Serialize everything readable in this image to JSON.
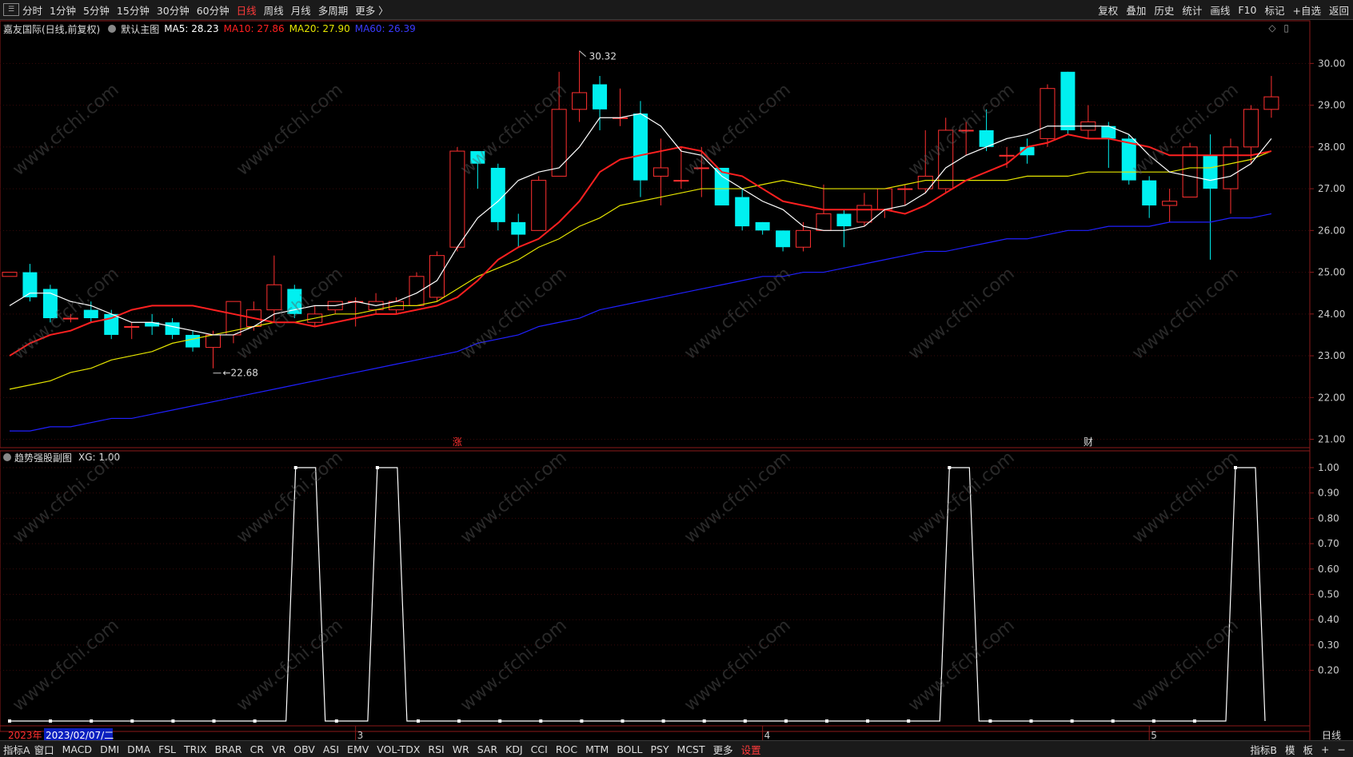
{
  "topbar": {
    "tabs": [
      "分时",
      "1分钟",
      "5分钟",
      "15分钟",
      "30分钟",
      "60分钟",
      "日线",
      "周线",
      "月线",
      "多周期",
      "更多 〉"
    ],
    "active_tab": "日线",
    "tools": [
      "复权",
      "叠加",
      "历史",
      "统计",
      "画线",
      "F10",
      "标记",
      "+自选",
      "返回"
    ]
  },
  "infobar": {
    "stock": "嘉友国际(日线,前复权)",
    "main_chart": "默认主图",
    "ma5": "MA5: 28.23",
    "ma10": "MA10: 27.86",
    "ma20": "MA20: 27.90",
    "ma60": "MA60: 26.39",
    "colors": {
      "ma5": "#ffffff",
      "ma10": "#ff2020",
      "ma20": "#e5e500",
      "ma60": "#2020ff"
    }
  },
  "main_chart": {
    "y_ticks": [
      "30.00",
      "29.00",
      "28.00",
      "27.00",
      "26.00",
      "25.00",
      "24.00",
      "23.00",
      "22.00",
      "21.00"
    ],
    "high_label": "30.32",
    "low_label": "22.68",
    "event_labels": [
      "涨",
      "财"
    ]
  },
  "sub_chart": {
    "title": "趋势强股副图",
    "value": "XG: 1.00",
    "y_ticks": [
      "1.00",
      "0.90",
      "0.80",
      "0.70",
      "0.60",
      "0.50",
      "0.40",
      "0.30",
      "0.20"
    ]
  },
  "date_axis": {
    "year": "2023年",
    "cursor_date": "2023/02/07/二",
    "month_marks": [
      "3",
      "4",
      "5"
    ],
    "period": "日线"
  },
  "chart_data": {
    "type": "candlestick",
    "candles": [
      [
        24.9,
        25.0,
        24.9,
        25.0
      ],
      [
        25.0,
        24.4,
        25.2,
        24.3
      ],
      [
        24.6,
        23.9,
        24.7,
        23.8
      ],
      [
        23.9,
        23.9,
        24.0,
        23.8
      ],
      [
        24.1,
        23.9,
        24.3,
        23.8
      ],
      [
        24.0,
        23.5,
        24.1,
        23.4
      ],
      [
        23.7,
        23.7,
        23.8,
        23.4
      ],
      [
        23.8,
        23.7,
        24.0,
        23.5
      ],
      [
        23.8,
        23.5,
        23.9,
        23.4
      ],
      [
        23.5,
        23.2,
        23.6,
        23.1
      ],
      [
        23.2,
        23.5,
        23.6,
        22.7
      ],
      [
        23.5,
        24.3,
        24.3,
        23.3
      ],
      [
        23.7,
        24.1,
        24.3,
        23.6
      ],
      [
        24.1,
        24.7,
        25.4,
        23.8
      ],
      [
        24.6,
        24.0,
        24.7,
        23.9
      ],
      [
        23.8,
        24.0,
        24.2,
        23.7
      ],
      [
        24.1,
        24.3,
        24.3,
        24.0
      ],
      [
        24.3,
        24.3,
        24.4,
        23.7
      ],
      [
        24.1,
        24.3,
        24.5,
        24.0
      ],
      [
        24.1,
        24.3,
        24.4,
        24.0
      ],
      [
        24.2,
        24.9,
        25.0,
        24.2
      ],
      [
        24.4,
        25.4,
        25.5,
        24.3
      ],
      [
        25.6,
        27.9,
        28.0,
        25.5
      ],
      [
        27.9,
        27.6,
        27.9,
        27.0
      ],
      [
        27.5,
        26.2,
        27.6,
        26.0
      ],
      [
        26.2,
        25.9,
        26.4,
        25.6
      ],
      [
        26.0,
        27.2,
        27.3,
        26.0
      ],
      [
        27.3,
        28.9,
        29.8,
        27.5
      ],
      [
        28.9,
        29.3,
        30.3,
        28.6
      ],
      [
        29.5,
        28.9,
        29.7,
        28.4
      ],
      [
        28.7,
        28.7,
        29.4,
        28.5
      ],
      [
        28.8,
        27.2,
        29.1,
        26.8
      ],
      [
        27.3,
        27.5,
        28.2,
        26.6
      ],
      [
        27.2,
        27.2,
        28.0,
        27.0
      ],
      [
        27.5,
        27.5,
        28.0,
        26.8
      ],
      [
        27.5,
        26.6,
        27.5,
        26.6
      ],
      [
        26.8,
        26.1,
        27.0,
        26.0
      ],
      [
        26.2,
        26.0,
        26.2,
        25.9
      ],
      [
        26.0,
        25.6,
        26.0,
        25.5
      ],
      [
        25.6,
        26.0,
        26.2,
        25.5
      ],
      [
        26.0,
        26.4,
        27.1,
        26.0
      ],
      [
        26.4,
        26.1,
        26.5,
        25.6
      ],
      [
        26.2,
        26.6,
        26.9,
        26.1
      ],
      [
        26.5,
        27.0,
        27.0,
        26.3
      ],
      [
        27.0,
        27.0,
        27.1,
        26.6
      ],
      [
        27.0,
        27.3,
        28.4,
        26.9
      ],
      [
        27.0,
        28.4,
        28.7,
        26.9
      ],
      [
        28.4,
        28.4,
        28.6,
        27.8
      ],
      [
        28.4,
        28.0,
        28.9,
        27.9
      ],
      [
        27.8,
        27.8,
        28.0,
        27.5
      ],
      [
        28.0,
        27.8,
        28.2,
        27.6
      ],
      [
        28.2,
        29.4,
        29.5,
        28.0
      ],
      [
        29.8,
        28.4,
        29.8,
        28.3
      ],
      [
        28.4,
        28.6,
        29.0,
        28.2
      ],
      [
        28.5,
        28.2,
        28.6,
        27.5
      ],
      [
        28.2,
        27.2,
        28.3,
        27.1
      ],
      [
        27.2,
        26.6,
        27.3,
        26.3
      ],
      [
        26.6,
        26.7,
        27.0,
        26.2
      ],
      [
        26.8,
        28.0,
        28.1,
        26.8
      ],
      [
        27.8,
        27.0,
        28.3,
        25.3
      ],
      [
        27.0,
        28.0,
        28.2,
        26.4
      ],
      [
        28.0,
        28.9,
        29.0,
        27.6
      ],
      [
        28.9,
        29.2,
        29.7,
        28.7
      ]
    ],
    "ma5": [
      24.2,
      24.5,
      24.5,
      24.3,
      24.2,
      24.0,
      23.8,
      23.8,
      23.7,
      23.6,
      23.5,
      23.5,
      23.7,
      24.0,
      24.1,
      24.2,
      24.2,
      24.3,
      24.2,
      24.3,
      24.5,
      24.8,
      25.6,
      26.3,
      26.7,
      27.2,
      27.4,
      27.5,
      28.0,
      28.7,
      28.7,
      28.8,
      28.5,
      27.9,
      27.8,
      27.3,
      27.0,
      26.7,
      26.5,
      26.1,
      26.0,
      26.0,
      26.1,
      26.5,
      26.6,
      26.9,
      27.5,
      27.8,
      28.0,
      28.2,
      28.3,
      28.5,
      28.5,
      28.5,
      28.5,
      28.3,
      27.8,
      27.4,
      27.3,
      27.2,
      27.3,
      27.6,
      28.2
    ],
    "ma10": [
      23.0,
      23.3,
      23.5,
      23.6,
      23.8,
      23.9,
      24.1,
      24.2,
      24.2,
      24.2,
      24.1,
      24.0,
      23.9,
      23.8,
      23.8,
      23.7,
      23.8,
      23.9,
      24.0,
      24.0,
      24.1,
      24.2,
      24.4,
      24.8,
      25.3,
      25.6,
      25.8,
      26.2,
      26.7,
      27.4,
      27.7,
      27.8,
      27.9,
      28.0,
      27.9,
      27.4,
      27.3,
      27.0,
      26.7,
      26.6,
      26.5,
      26.5,
      26.5,
      26.5,
      26.4,
      26.6,
      26.9,
      27.2,
      27.4,
      27.6,
      28.0,
      28.1,
      28.3,
      28.2,
      28.2,
      28.1,
      28.0,
      27.8,
      27.8,
      27.8,
      27.8,
      27.8,
      27.9
    ],
    "ma20": [
      22.2,
      22.3,
      22.4,
      22.6,
      22.7,
      22.9,
      23.0,
      23.1,
      23.3,
      23.4,
      23.5,
      23.6,
      23.7,
      23.8,
      23.8,
      23.9,
      24.0,
      24.0,
      24.1,
      24.2,
      24.2,
      24.3,
      24.6,
      24.9,
      25.1,
      25.3,
      25.6,
      25.8,
      26.1,
      26.3,
      26.6,
      26.7,
      26.8,
      26.9,
      27.0,
      27.0,
      27.0,
      27.1,
      27.2,
      27.1,
      27.0,
      27.0,
      27.0,
      27.0,
      27.1,
      27.2,
      27.2,
      27.2,
      27.2,
      27.2,
      27.3,
      27.3,
      27.3,
      27.4,
      27.4,
      27.4,
      27.4,
      27.4,
      27.5,
      27.5,
      27.6,
      27.7,
      27.9
    ],
    "ma60": [
      21.2,
      21.2,
      21.3,
      21.3,
      21.4,
      21.5,
      21.5,
      21.6,
      21.7,
      21.8,
      21.9,
      22.0,
      22.1,
      22.2,
      22.3,
      22.4,
      22.5,
      22.6,
      22.7,
      22.8,
      22.9,
      23.0,
      23.1,
      23.3,
      23.4,
      23.5,
      23.7,
      23.8,
      23.9,
      24.1,
      24.2,
      24.3,
      24.4,
      24.5,
      24.6,
      24.7,
      24.8,
      24.9,
      24.9,
      25.0,
      25.0,
      25.1,
      25.2,
      25.3,
      25.4,
      25.5,
      25.5,
      25.6,
      25.7,
      25.8,
      25.8,
      25.9,
      26.0,
      26.0,
      26.1,
      26.1,
      26.1,
      26.2,
      26.2,
      26.2,
      26.3,
      26.3,
      26.4
    ],
    "xg": [
      0,
      0,
      0,
      0,
      0,
      0,
      0,
      1,
      0,
      1,
      0,
      0,
      0,
      0,
      0,
      0,
      0,
      0,
      0,
      0,
      0,
      0,
      0,
      1,
      0,
      0,
      0,
      0,
      0,
      0,
      1
    ],
    "price_range": [
      20.8,
      30.6
    ],
    "xg_range": [
      0,
      1
    ]
  }
}
